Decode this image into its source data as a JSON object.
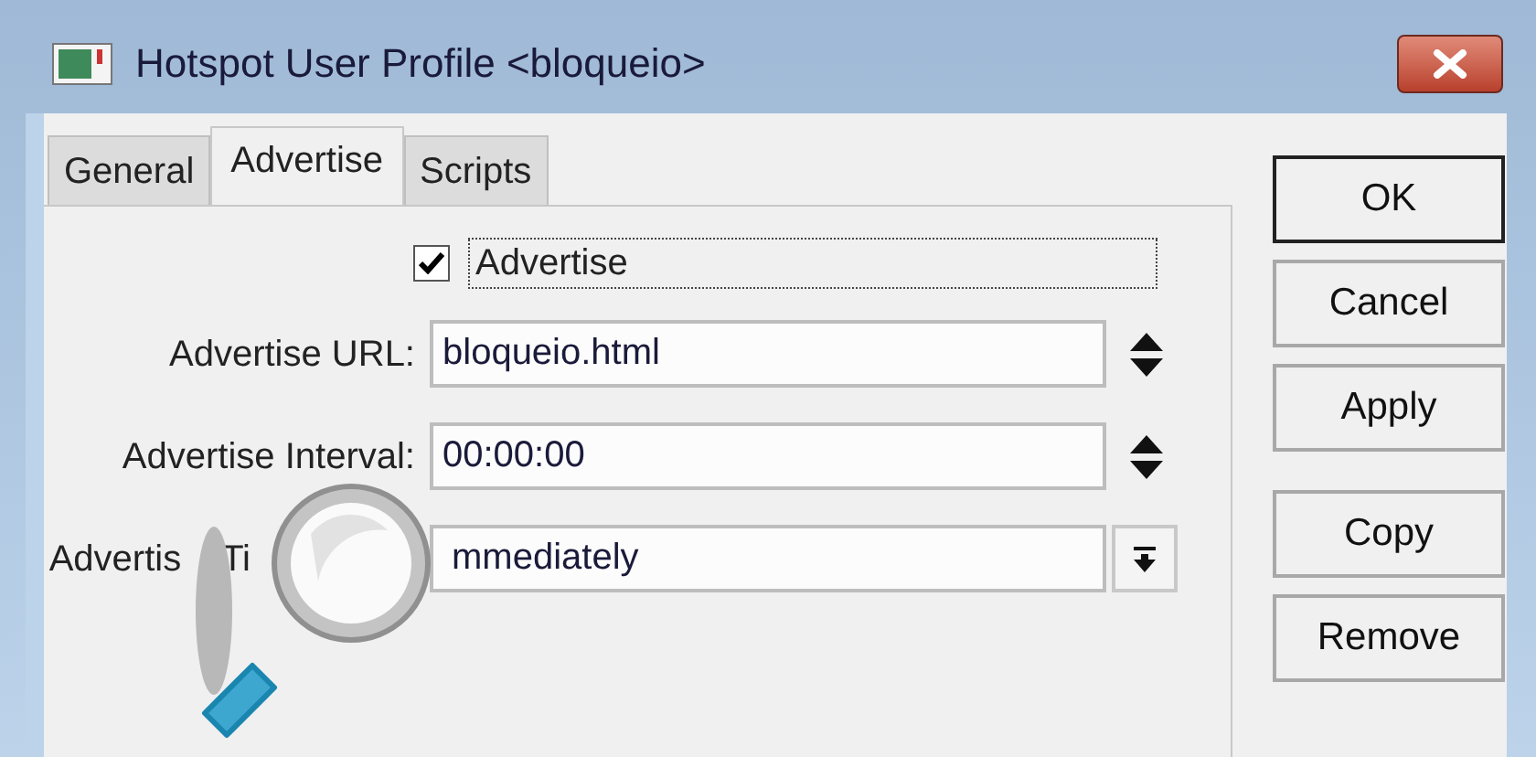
{
  "window": {
    "title": "Hotspot User Profile <bloqueio>"
  },
  "tabs": [
    {
      "label": "General",
      "selected": false
    },
    {
      "label": "Advertise",
      "selected": true
    },
    {
      "label": "Scripts",
      "selected": false
    }
  ],
  "checkbox": {
    "label": "Advertise",
    "checked": true
  },
  "fields": [
    {
      "kind": "spin",
      "label": [
        "Advertise URL:"
      ],
      "value": "bloqueio.html"
    },
    {
      "kind": "spin",
      "label": [
        "Advertise Interval:"
      ],
      "value": "00:00:00"
    },
    {
      "kind": "dropdown",
      "label": [
        "Advertis",
        "Ti"
      ],
      "value": "mmediately"
    }
  ],
  "button_groups": [
    [
      {
        "label": "OK",
        "default": true
      },
      {
        "label": "Cancel",
        "default": false
      },
      {
        "label": "Apply",
        "default": false
      }
    ],
    [
      {
        "label": "Copy",
        "default": false
      },
      {
        "label": "Remove",
        "default": false
      }
    ]
  ]
}
